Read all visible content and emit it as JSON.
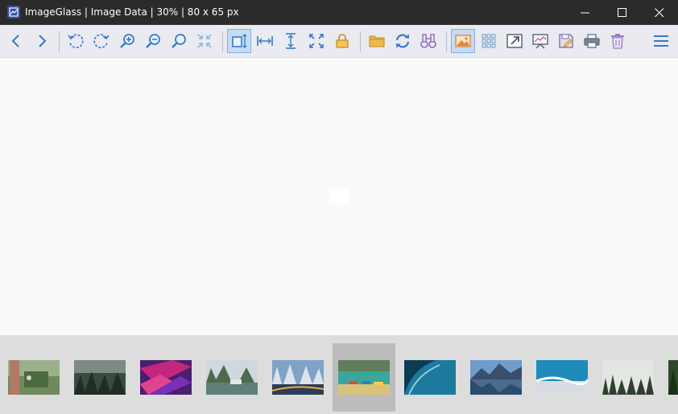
{
  "window": {
    "title": "ImageGlass  |  Image Data  |  30%  |  80 x 65 px",
    "app_icon": "imageglass-logo-icon",
    "controls": [
      "minimize-icon",
      "maximize-icon",
      "close-icon"
    ]
  },
  "toolbar": {
    "buttons": [
      {
        "name": "back-button",
        "icon": "chevron-left-icon"
      },
      {
        "name": "forward-button",
        "icon": "chevron-right-icon"
      },
      {
        "name": "rotate-left-button",
        "icon": "rotate-left-icon"
      },
      {
        "name": "rotate-right-button",
        "icon": "rotate-right-icon"
      },
      {
        "name": "zoom-in-button",
        "icon": "zoom-in-icon"
      },
      {
        "name": "zoom-out-button",
        "icon": "zoom-out-icon"
      },
      {
        "name": "actual-size-button",
        "icon": "magnifier-icon"
      },
      {
        "name": "zoom-to-fit-button",
        "icon": "compress-arrows-icon"
      },
      {
        "name": "auto-zoom-button",
        "icon": "auto-zoom-icon",
        "active": true
      },
      {
        "name": "scale-to-width-button",
        "icon": "fit-width-icon"
      },
      {
        "name": "scale-to-height-button",
        "icon": "fit-height-icon"
      },
      {
        "name": "full-screen-button",
        "icon": "expand-arrows-icon"
      },
      {
        "name": "lock-zoom-button",
        "icon": "lock-icon"
      },
      {
        "name": "open-file-button",
        "icon": "folder-icon"
      },
      {
        "name": "refresh-button",
        "icon": "refresh-icon"
      },
      {
        "name": "go-to-image-button",
        "icon": "binoculars-icon"
      },
      {
        "name": "thumbnail-bar-button",
        "icon": "image-icon",
        "active": true
      },
      {
        "name": "checkerboard-button",
        "icon": "grid-icon"
      },
      {
        "name": "open-with-button",
        "icon": "open-external-icon"
      },
      {
        "name": "slideshow-button",
        "icon": "slideshow-icon"
      },
      {
        "name": "save-button",
        "icon": "save-icon"
      },
      {
        "name": "print-button",
        "icon": "printer-icon"
      },
      {
        "name": "delete-button",
        "icon": "trash-icon"
      },
      {
        "name": "menu-button",
        "icon": "hamburger-menu-icon"
      }
    ]
  },
  "thumbnails": {
    "selected_index": 5,
    "items": [
      {
        "subject": "tree trunk forest"
      },
      {
        "subject": "misty pine forest"
      },
      {
        "subject": "purple abstract geometry"
      },
      {
        "subject": "karst bay with boat"
      },
      {
        "subject": "snowy trees night lights"
      },
      {
        "subject": "boats on lake"
      },
      {
        "subject": "ocean wave"
      },
      {
        "subject": "mountain lake sunrise"
      },
      {
        "subject": "aerial ocean shore"
      },
      {
        "subject": "foggy forest"
      },
      {
        "subject": "green forest"
      }
    ]
  }
}
